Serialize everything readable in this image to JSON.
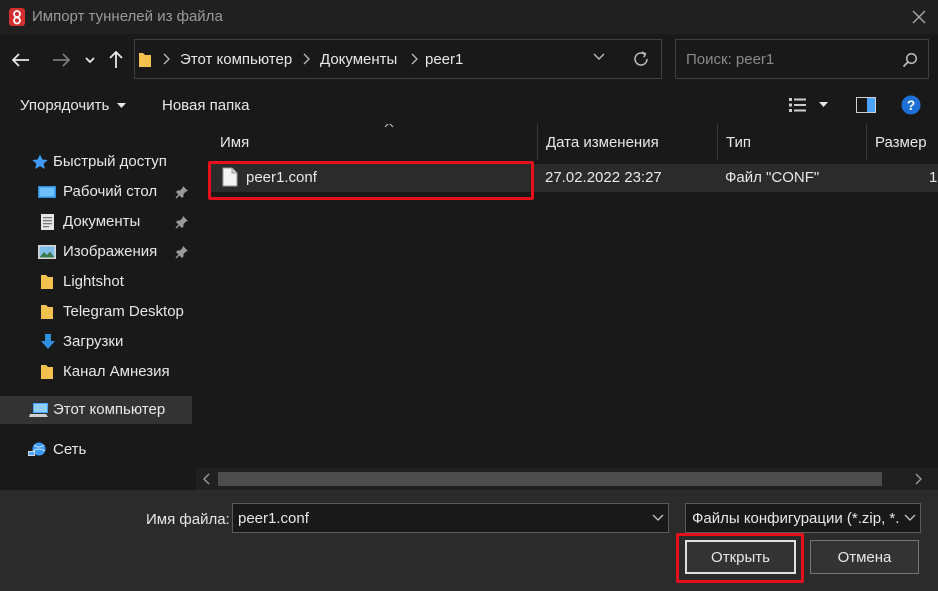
{
  "window": {
    "title": "Импорт туннелей из файла"
  },
  "address": {
    "crumbs": [
      "Этот компьютер",
      "Документы",
      "peer1"
    ]
  },
  "search": {
    "placeholder": "Поиск: peer1"
  },
  "toolbar": {
    "organize_label": "Упорядочить",
    "new_folder_label": "Новая папка"
  },
  "sidebar": {
    "items": [
      {
        "label": "Быстрый доступ",
        "icon": "star-icon"
      },
      {
        "label": "Рабочий стол",
        "icon": "desktop-folder-icon",
        "pinned": true
      },
      {
        "label": "Документы",
        "icon": "documents-folder-icon",
        "pinned": true
      },
      {
        "label": "Изображения",
        "icon": "pictures-folder-icon",
        "pinned": true
      },
      {
        "label": "Lightshot",
        "icon": "folder-icon"
      },
      {
        "label": "Telegram Desktop",
        "icon": "folder-icon"
      },
      {
        "label": "Загрузки",
        "icon": "download-icon"
      },
      {
        "label": "Канал Амнезия",
        "icon": "folder-icon"
      },
      {
        "label": "Этот компьютер",
        "icon": "computer-icon",
        "selected": true
      },
      {
        "label": "Сеть",
        "icon": "network-icon"
      }
    ]
  },
  "files": {
    "columns": [
      "Имя",
      "Дата изменения",
      "Тип",
      "Размер"
    ],
    "rows": [
      {
        "name": "peer1.conf",
        "date": "27.02.2022 23:27",
        "type": "Файл \"CONF\"",
        "size": "1"
      }
    ]
  },
  "bottom": {
    "filename_label": "Имя файла:",
    "filename_value": "peer1.conf",
    "filetype_value": "Файлы конфигурации (*.zip, *.",
    "open_label": "Открыть",
    "cancel_label": "Отмена"
  },
  "colors": {
    "background": "#191919",
    "bottom_panel": "#2b2b2b",
    "highlight": "#e8101c",
    "help_icon": "#1e70d6",
    "folder": "#f2c14e"
  }
}
